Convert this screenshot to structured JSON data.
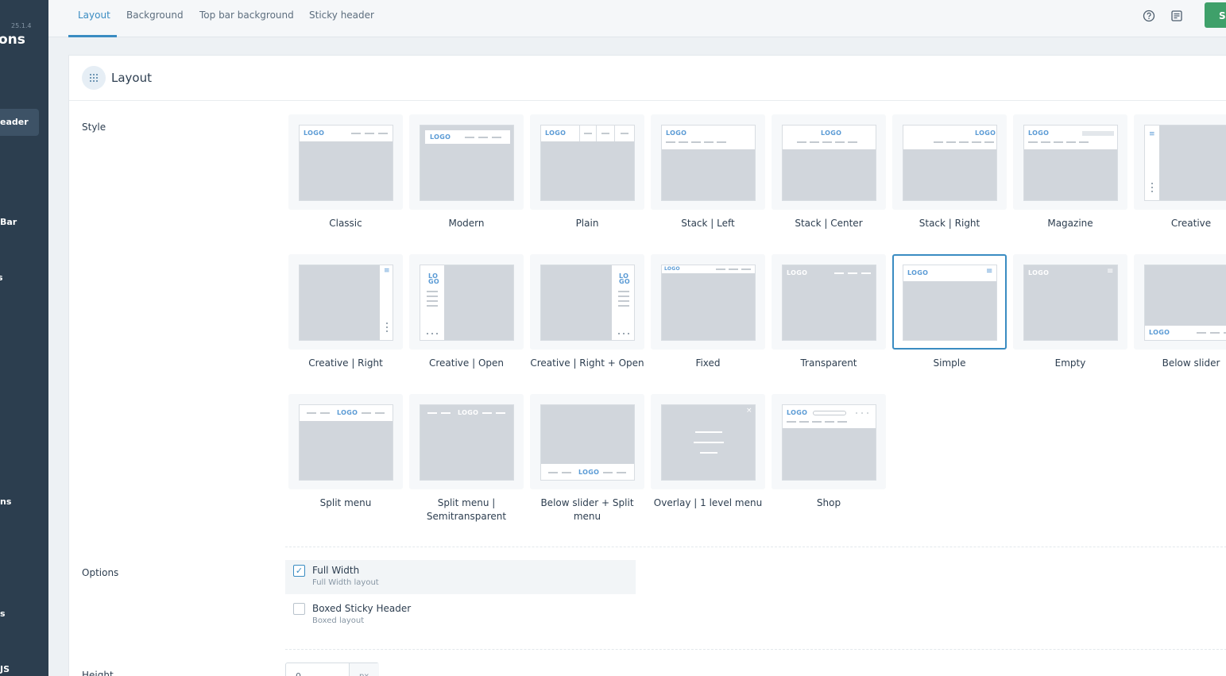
{
  "sidebar": {
    "version": "25.1.4",
    "title": "ons",
    "items": [
      {
        "label": "eader",
        "active": true
      },
      {
        "label": "Bar"
      },
      {
        "label": "s"
      },
      {
        "label": "ns"
      },
      {
        "label": "s"
      },
      {
        "label": "JS"
      }
    ]
  },
  "topbar": {
    "tabs": [
      {
        "label": "Layout",
        "active": true
      },
      {
        "label": "Background"
      },
      {
        "label": "Top bar background"
      },
      {
        "label": "Sticky header"
      }
    ],
    "icons": [
      "help-circle-icon",
      "notes-icon"
    ],
    "save_label": "Sa"
  },
  "panel": {
    "icon": "grid-icon",
    "title": "Layout",
    "style_label": "Style",
    "options_label": "Options",
    "height_label": "Height",
    "selected_style": "Simple",
    "styles": [
      {
        "label": "Classic"
      },
      {
        "label": "Modern"
      },
      {
        "label": "Plain"
      },
      {
        "label": "Stack | Left"
      },
      {
        "label": "Stack | Center"
      },
      {
        "label": "Stack | Right"
      },
      {
        "label": "Magazine"
      },
      {
        "label": "Creative"
      },
      {
        "label": "Creative | Right"
      },
      {
        "label": "Creative | Open"
      },
      {
        "label": "Creative | Right + Open"
      },
      {
        "label": "Fixed"
      },
      {
        "label": "Transparent"
      },
      {
        "label": "Simple"
      },
      {
        "label": "Empty"
      },
      {
        "label": "Below slider"
      },
      {
        "label": "Split menu"
      },
      {
        "label": "Split menu | Semitransparent"
      },
      {
        "label": "Below slider + Split menu"
      },
      {
        "label": "Overlay | 1 level menu"
      },
      {
        "label": "Shop"
      }
    ],
    "logo_text": "LOGO",
    "logo_split_1": "LO",
    "logo_split_2": "GO",
    "options": [
      {
        "label": "Full Width",
        "sub": "Full Width layout",
        "checked": true
      },
      {
        "label": "Boxed Sticky Header",
        "sub": "Boxed layout",
        "checked": false
      }
    ],
    "height": {
      "value": "0",
      "unit": "px"
    }
  },
  "colors": {
    "accent": "#3a8cc2",
    "save": "#3fa06a",
    "sidebar": "#2c3e4f"
  }
}
